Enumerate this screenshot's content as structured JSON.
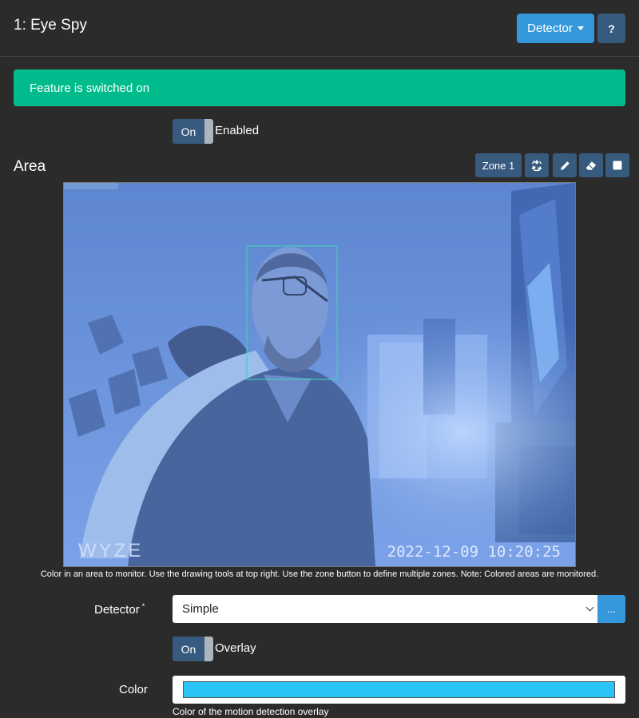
{
  "header": {
    "title": "1: Eye Spy",
    "detector_button": "Detector",
    "help_button": "?"
  },
  "alert": {
    "text": "Feature is switched on"
  },
  "enabled_toggle": {
    "state": "On",
    "label": "Enabled"
  },
  "area": {
    "title": "Area",
    "zone_button": "Zone 1",
    "tools": [
      "recycle-icon",
      "pencil-icon",
      "eraser-icon",
      "stop-icon"
    ],
    "camera": {
      "brand": "WYZE",
      "timestamp": "2022-12-09 10:20:25"
    },
    "hint": "Color in an area to monitor. Use the drawing tools at top right. Use the zone button to define multiple zones. Note: Colored areas are monitored."
  },
  "detector": {
    "label": "Detector",
    "required_mark": "*",
    "value": "Simple",
    "more_button": "..."
  },
  "overlay_toggle": {
    "state": "On",
    "label": "Overlay"
  },
  "color": {
    "label": "Color",
    "value": "#29c4f5",
    "help": "Color of the motion detection overlay"
  },
  "colors": {
    "primary": "#3498db",
    "secondary": "#375a7f",
    "success": "#00bc8c",
    "background": "#2b2b2b"
  }
}
